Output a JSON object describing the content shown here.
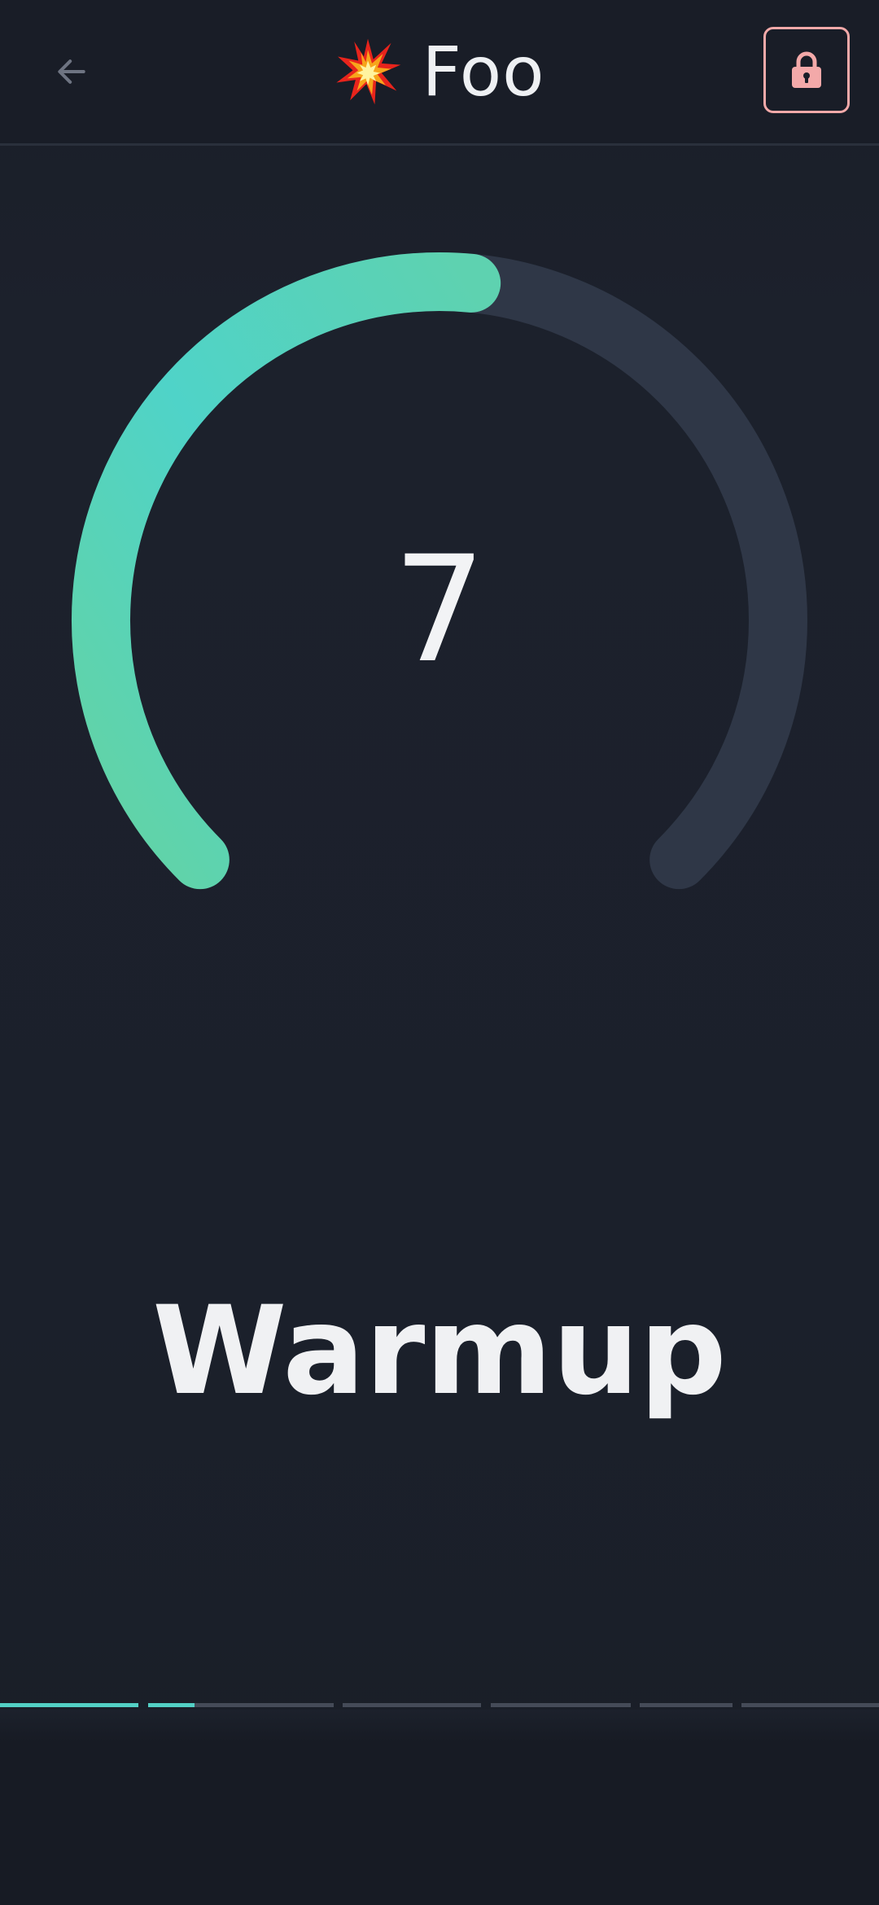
{
  "header": {
    "title": "Foo",
    "back_icon": "arrow-left-icon",
    "title_icon": "collision-emoji",
    "lock_icon": "lock-icon",
    "lock_color": "#f3a9a9"
  },
  "gauge": {
    "value": "7",
    "fill_fraction": 0.52,
    "fill_color_start": "#64d3a3",
    "fill_color_end": "#4fd3c8",
    "track_color": "#2f3747"
  },
  "phase": {
    "label": "Warmup"
  },
  "progress": {
    "accent": "#53d0c5",
    "segments": [
      {
        "fill": 1.0
      },
      {
        "fill": 0.25
      },
      {
        "fill": 0.0
      },
      {
        "fill": 0.0
      },
      {
        "fill": 0.0
      },
      {
        "fill": 0.0
      },
      {
        "fill": 0.0
      }
    ]
  }
}
